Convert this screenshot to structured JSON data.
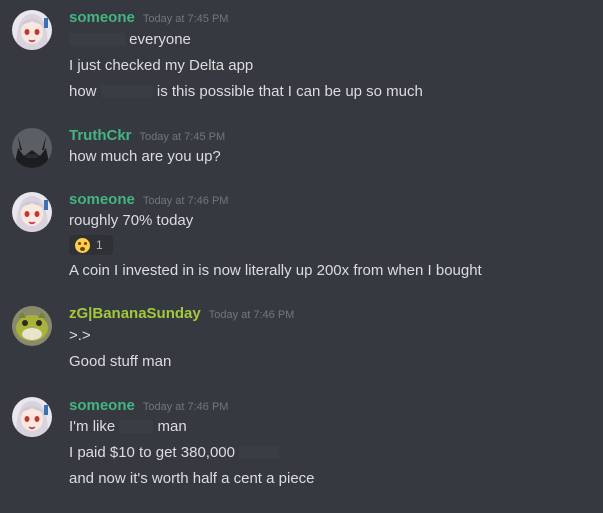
{
  "colors": {
    "background": "#36393f",
    "username_someone": "#43b581",
    "username_truthckr": "#43b581",
    "username_zg": "#a3c93b",
    "timestamp": "#72767d",
    "message_text": "#dcddde"
  },
  "messages": [
    {
      "username": "someone",
      "timestamp": "Today at 7:45 PM",
      "avatar_icon": "anime-girl-avatar-icon",
      "lines": [
        "everyone",
        "I just checked my Delta app",
        "how",
        "is this possible that I can be up so much"
      ]
    },
    {
      "username": "TruthCkr",
      "timestamp": "Today at 7:45 PM",
      "avatar_icon": "dark-horned-avatar-icon",
      "lines": [
        "how much are you up?"
      ]
    },
    {
      "username": "someone",
      "timestamp": "Today at 7:46 PM",
      "avatar_icon": "anime-girl-avatar-icon",
      "lines": [
        "roughly 70% today",
        "A coin I invested in is now literally up 200x from when I bought"
      ],
      "reaction": {
        "emoji": "astonished-face-icon",
        "count": "1"
      }
    },
    {
      "username": "zG|BananaSunday",
      "timestamp": "Today at 7:46 PM",
      "avatar_icon": "creature-avatar-icon",
      "lines": [
        ">.>",
        "Good stuff man"
      ]
    },
    {
      "username": "someone",
      "timestamp": "Today at 7:46 PM",
      "avatar_icon": "anime-girl-avatar-icon",
      "lines": [
        "I'm like",
        "man",
        "I paid $10 to get 380,000",
        "and now it's worth half a cent a piece"
      ]
    }
  ]
}
